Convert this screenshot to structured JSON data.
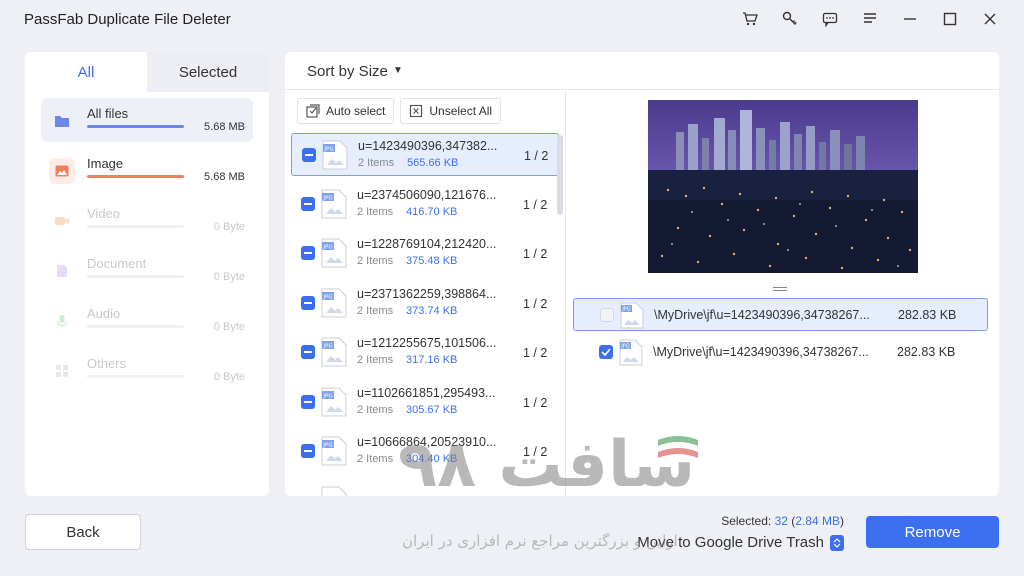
{
  "window": {
    "title": "PassFab Duplicate File Deleter"
  },
  "left_panel": {
    "tabs": [
      {
        "label": "All"
      },
      {
        "label": "Selected"
      }
    ],
    "categories": [
      {
        "label": "All files",
        "size": "5.68 MB",
        "progress": 1.0,
        "color": "#6b87e8",
        "icon": "folder-icon"
      },
      {
        "label": "Image",
        "size": "5.68 MB",
        "progress": 1.0,
        "color": "#ef7f5e",
        "icon": "image-icon"
      },
      {
        "label": "Video",
        "size": "0 Byte",
        "progress": 0,
        "icon": "video-icon"
      },
      {
        "label": "Document",
        "size": "0 Byte",
        "progress": 0,
        "icon": "document-icon"
      },
      {
        "label": "Audio",
        "size": "0 Byte",
        "progress": 0,
        "icon": "audio-icon"
      },
      {
        "label": "Others",
        "size": "0 Byte",
        "progress": 0,
        "icon": "grid-icon"
      }
    ]
  },
  "main": {
    "sort_label": "Sort by Size",
    "auto_select": "Auto select",
    "unselect_all": "Unselect All",
    "groups": [
      {
        "name": "u=1423490396,347382...",
        "count": "2 Items",
        "size": "565.66 KB",
        "ratio": "1 / 2"
      },
      {
        "name": "u=2374506090,121676...",
        "count": "2 Items",
        "size": "416.70 KB",
        "ratio": "1 / 2"
      },
      {
        "name": "u=1228769104,212420...",
        "count": "2 Items",
        "size": "375.48 KB",
        "ratio": "1 / 2"
      },
      {
        "name": "u=2371362259,398864...",
        "count": "2 Items",
        "size": "373.74 KB",
        "ratio": "1 / 2"
      },
      {
        "name": "u=1212255675,101506...",
        "count": "2 Items",
        "size": "317.16 KB",
        "ratio": "1 / 2"
      },
      {
        "name": "u=1102661851,295493...",
        "count": "2 Items",
        "size": "305.67 KB",
        "ratio": "1 / 2"
      },
      {
        "name": "u=10666864,20523910...",
        "count": "2 Items",
        "size": "304.40 KB",
        "ratio": "1 / 2"
      }
    ],
    "files": [
      {
        "path": "\\MyDrive\\jf\\u=1423490396,34738267...",
        "size": "282.83 KB"
      },
      {
        "path": "\\MyDrive\\jf\\u=1423490396,34738267...",
        "size": "282.83 KB"
      }
    ],
    "file_badge": "JPG"
  },
  "footer": {
    "back": "Back",
    "selected_prefix": "Selected:",
    "selected_count": "32",
    "selected_size": "2.84 MB",
    "move_option": "Move to Google Drive Trash",
    "remove": "Remove"
  },
  "watermark": {
    "main": "سافت ۹۸",
    "sub": "اولین و بزرگترین مراجع نرم افزاری در ایران"
  }
}
